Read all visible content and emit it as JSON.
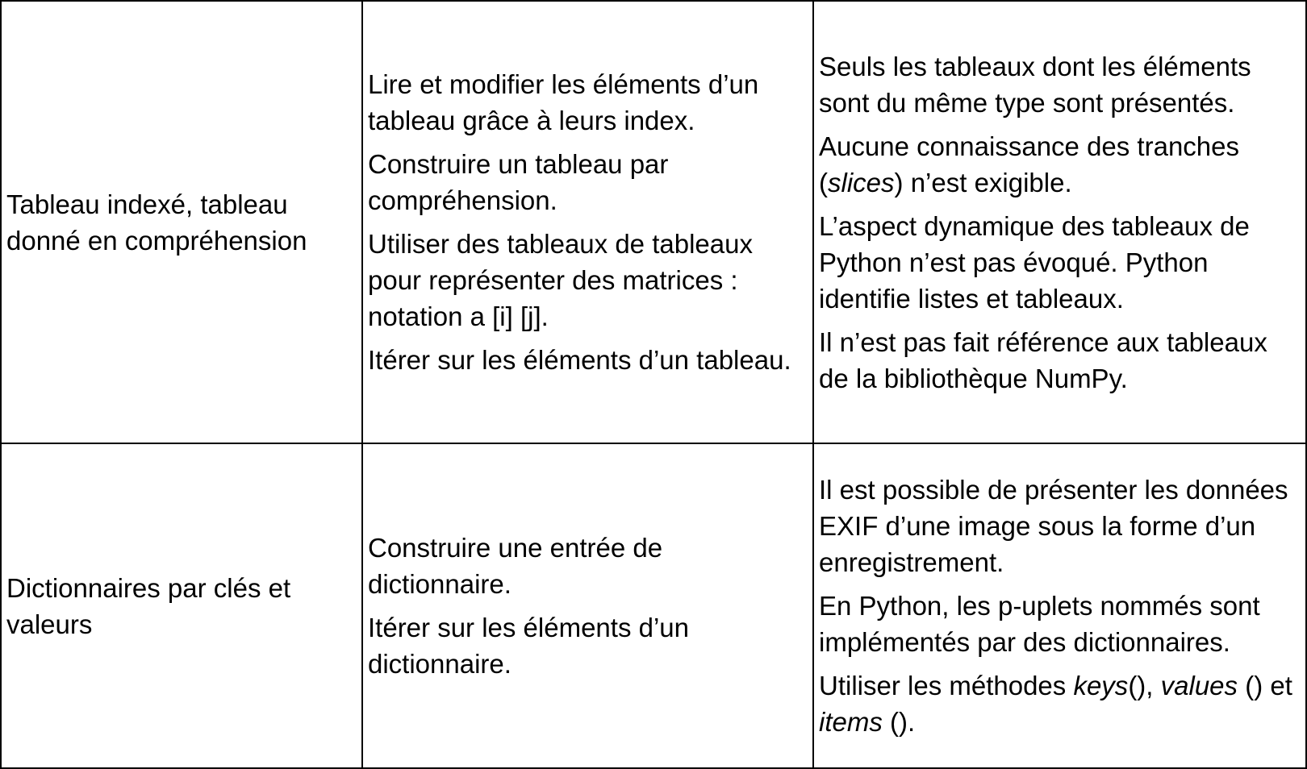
{
  "rows": [
    {
      "topic": "Tableau indexé, tableau donné en compréhension",
      "skills": [
        "Lire et modifier les éléments d’un tableau grâce à leurs index.",
        "Construire un tableau par compréhension.",
        "Utiliser des tableaux de tableaux pour représenter des matrices : notation a [i] [j].",
        "Itérer sur les éléments d’un tableau."
      ],
      "comments": [
        "Seuls les tableaux dont les éléments sont du même type sont présentés.",
        {
          "pre": "Aucune connaissance des tranches (",
          "it": "slices",
          "post": ") n’est exigible."
        },
        "L’aspect dynamique des tableaux de Python n’est pas évoqué. Python identifie listes et tableaux.",
        "Il n’est pas fait référence aux tableaux de la bibliothèque NumPy."
      ]
    },
    {
      "topic": "Dictionnaires par clés et valeurs",
      "skills": [
        "Construire une entrée de dictionnaire.",
        "Itérer sur les éléments d’un dictionnaire."
      ],
      "comments": [
        "Il est possible de présenter les données EXIF d’une image sous la forme d’un enregistrement.",
        "En Python, les p-uplets nommés sont implémentés par des dictionnaires.",
        {
          "t1": "Utiliser les méthodes ",
          "i1": "keys",
          "t2": "(), ",
          "i2": "values",
          "t3": " () et ",
          "i3": "items",
          "t4": " ()."
        }
      ]
    }
  ]
}
